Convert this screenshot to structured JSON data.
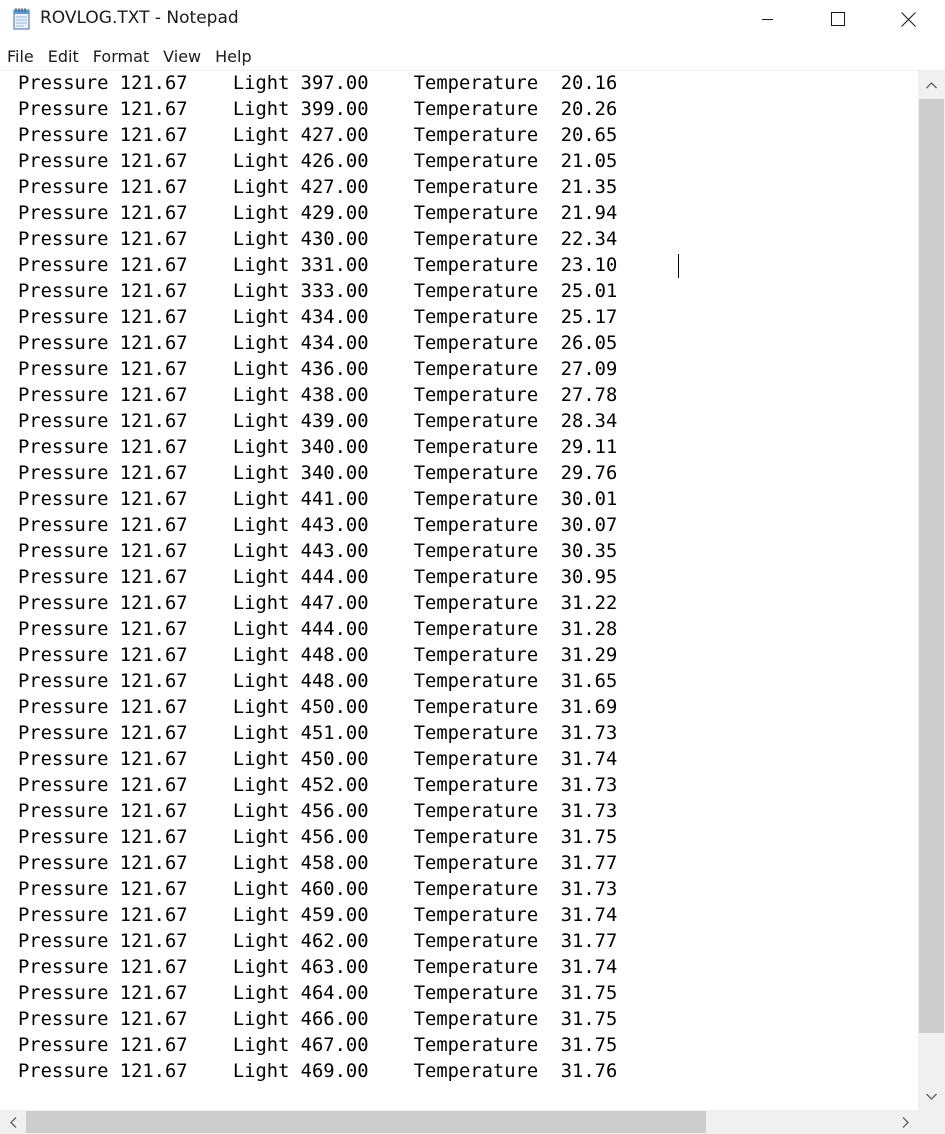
{
  "window": {
    "title": "ROVLOG.TXT - Notepad",
    "icon": "notepad-icon"
  },
  "controls": {
    "minimize_icon": "minimize-icon",
    "maximize_icon": "maximize-icon",
    "close_icon": "close-icon"
  },
  "menu": {
    "items": [
      "File",
      "Edit",
      "Format",
      "View",
      "Help"
    ]
  },
  "document": {
    "lines": [
      "Pressure 121.67    Light 397.00    Temperature  20.16",
      "Pressure 121.67    Light 399.00    Temperature  20.26",
      "Pressure 121.67    Light 427.00    Temperature  20.65",
      "Pressure 121.67    Light 426.00    Temperature  21.05",
      "Pressure 121.67    Light 427.00    Temperature  21.35",
      "Pressure 121.67    Light 429.00    Temperature  21.94",
      "Pressure 121.67    Light 430.00    Temperature  22.34",
      "Pressure 121.67    Light 331.00    Temperature  23.10",
      "Pressure 121.67    Light 333.00    Temperature  25.01",
      "Pressure 121.67    Light 434.00    Temperature  25.17",
      "Pressure 121.67    Light 434.00    Temperature  26.05",
      "Pressure 121.67    Light 436.00    Temperature  27.09",
      "Pressure 121.67    Light 438.00    Temperature  27.78",
      "Pressure 121.67    Light 439.00    Temperature  28.34",
      "Pressure 121.67    Light 340.00    Temperature  29.11",
      "Pressure 121.67    Light 340.00    Temperature  29.76",
      "Pressure 121.67    Light 441.00    Temperature  30.01",
      "Pressure 121.67    Light 443.00    Temperature  30.07",
      "Pressure 121.67    Light 443.00    Temperature  30.35",
      "Pressure 121.67    Light 444.00    Temperature  30.95",
      "Pressure 121.67    Light 447.00    Temperature  31.22",
      "Pressure 121.67    Light 444.00    Temperature  31.28",
      "Pressure 121.67    Light 448.00    Temperature  31.29",
      "Pressure 121.67    Light 448.00    Temperature  31.65",
      "Pressure 121.67    Light 450.00    Temperature  31.69",
      "Pressure 121.67    Light 451.00    Temperature  31.73",
      "Pressure 121.67    Light 450.00    Temperature  31.74",
      "Pressure 121.67    Light 452.00    Temperature  31.73",
      "Pressure 121.67    Light 456.00    Temperature  31.73",
      "Pressure 121.67    Light 456.00    Temperature  31.75",
      "Pressure 121.67    Light 458.00    Temperature  31.77",
      "Pressure 121.67    Light 460.00    Temperature  31.73",
      "Pressure 121.67    Light 459.00    Temperature  31.74",
      "Pressure 121.67    Light 462.00    Temperature  31.77",
      "Pressure 121.67    Light 463.00    Temperature  31.74",
      "Pressure 121.67    Light 464.00    Temperature  31.75",
      "Pressure 121.67    Light 466.00    Temperature  31.75",
      "Pressure 121.67    Light 467.00    Temperature  31.75",
      "Pressure 121.67    Light 469.00    Temperature  31.76"
    ]
  },
  "scrollbars": {
    "vertical_up_icon": "chevron-up-icon",
    "vertical_down_icon": "chevron-down-icon",
    "horizontal_left_icon": "chevron-left-icon",
    "horizontal_right_icon": "chevron-right-icon"
  },
  "colors": {
    "scrollbar_track": "#f0f0f0",
    "scrollbar_thumb": "#cdcdcd",
    "text": "#000000"
  }
}
